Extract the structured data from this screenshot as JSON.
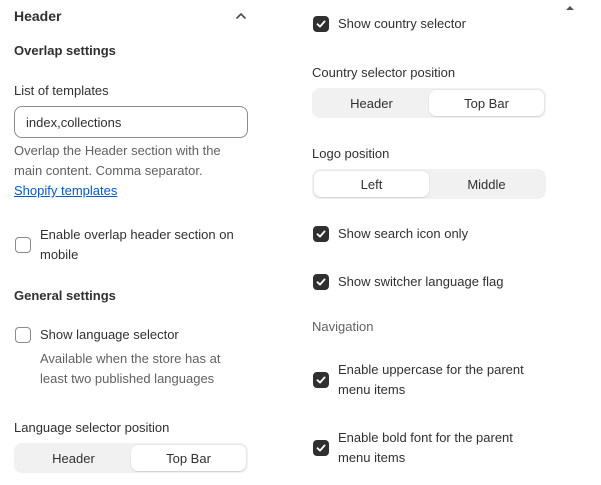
{
  "header": {
    "title": "Header",
    "collapse_icon": "chevron-up-icon"
  },
  "overlap": {
    "heading": "Overlap settings",
    "templates_label": "List of templates",
    "templates_value": "index,collections",
    "help_line1": "Overlap the Header section with the",
    "help_line2": "main content. Comma separator.",
    "help_link": "Shopify templates",
    "mobile_label_line1": "Enable overlap header section on",
    "mobile_label_line2": "mobile",
    "mobile_checked": false
  },
  "general": {
    "heading": "General settings",
    "language_label": "Show language selector",
    "language_checked": false,
    "language_help_line1": "Available when the store has at",
    "language_help_line2": "least two published languages",
    "language_position_label": "Language selector position",
    "language_position_options": [
      "Header",
      "Top Bar"
    ],
    "language_position_selected": "Top Bar"
  },
  "right": {
    "country_label": "Show country selector",
    "country_checked": true,
    "country_position_label": "Country selector position",
    "country_position_options": [
      "Header",
      "Top Bar"
    ],
    "country_position_selected": "Top Bar",
    "logo_position_label": "Logo position",
    "logo_position_options": [
      "Left",
      "Middle"
    ],
    "logo_position_selected": "Left",
    "search_icon_label": "Show search icon only",
    "search_icon_checked": true,
    "switcher_flag_label": "Show switcher language flag",
    "switcher_flag_checked": true,
    "navigation_heading": "Navigation",
    "uppercase_line1": "Enable uppercase for the parent",
    "uppercase_line2": "menu items",
    "uppercase_checked": true,
    "bold_line1": "Enable bold font for the parent",
    "bold_line2": "menu items",
    "bold_checked": true
  },
  "colors": {
    "text": "#303030",
    "muted": "#616161",
    "link": "#005bd3",
    "segment_bg": "#f1f1f1",
    "checkbox_checked": "#303030"
  }
}
